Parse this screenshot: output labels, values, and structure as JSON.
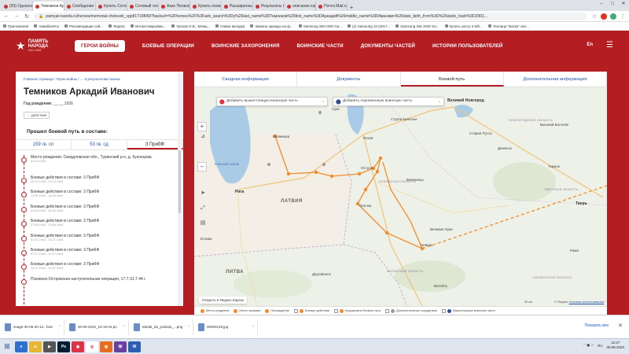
{
  "browser": {
    "tabs": [
      {
        "label": "(93) Одноклассн",
        "active": false
      },
      {
        "label": "Темников Аркади",
        "active": true
      },
      {
        "label": "Сообщения",
        "active": false
      },
      {
        "label": "Купить Сотовый",
        "active": false
      },
      {
        "label": "Сотовый телефо",
        "active": false
      },
      {
        "label": "Ахах Полиэфир",
        "active": false
      },
      {
        "label": "Купить полиэфир",
        "active": false
      },
      {
        "label": "Расширенный п",
        "active": false
      },
      {
        "label": "Результаты поис",
        "active": false
      },
      {
        "label": "описание карты",
        "active": false
      },
      {
        "label": "Почта Mail.ru",
        "active": false
      }
    ],
    "new_tab": "+",
    "win_min": "–",
    "win_max": "□",
    "win_close": "✕",
    "url": "pamyat-naroda.ru/heroes/memorial-chelovek_vpp81719849/?backurl=%2Fheroes%2F%3Fadv_search%3Dy%26last_name%3DТемников%26first_name%3DАркадий%26middle_name%3DИванович%26date_birth_from%3D%26static_hash%3D2901...",
    "bookmarks": [
      "Приложения",
      "Авиабилеты",
      "Рекомендации сай...",
      "Яндекс",
      "Интертовары/мы...",
      "Уроков О.В., Мемц...",
      "Новая вкладка",
      "Замена одежды на ф...",
      "Samsung SM-J330 Ga...",
      "(2) Samsung J3 (2017...",
      "Samsung SM-J330 Ga...",
      "Купить кассу в Wb...",
      "Теплица \"Батик\" сво..."
    ]
  },
  "site": {
    "logo_line1": "ПАМЯТЬ",
    "logo_line2": "НАРОДА",
    "logo_years": "1941-1945",
    "nav": [
      "ГЕРОИ ВОЙНЫ",
      "БОЕВЫЕ ОПЕРАЦИИ",
      "ВОИНСКИЕ ЗАХОРОНЕНИЯ",
      "ВОИНСКИЕ ЧАСТИ",
      "ДОКУМЕНТЫ ЧАСТЕЙ",
      "ИСТОРИИ ПОЛЬЗОВАТЕЛЕЙ"
    ],
    "lang": "En"
  },
  "hero": {
    "crumb_home": "Главная страница",
    "crumb_sep": " / ",
    "crumb_heroes": "Герои войны",
    "crumb_back": "← К результатам поиска",
    "name": "Темников Аркадий Иванович",
    "birth_label": "Год рождения:",
    "birth_value": "__.__.1926",
    "actions": "Действия",
    "route_title": "Прошел боевой путь в составе:",
    "units": [
      "159 гв. сп",
      "53 гв. сд",
      "3 ПрибФ"
    ],
    "timeline": [
      {
        "title": "Место рождения: Свердловская обл., Туринский р-н, д. Кузнецова",
        "date": "01.01.1926"
      },
      {
        "title": "Боевые действия в составе: 3 ПрибФ",
        "date": "26.12.1943 - 02.12.1944"
      },
      {
        "title": "Боевые действия в составе: 3 ПрибФ",
        "date": "12.05.1944 - 16.05.1944"
      },
      {
        "title": "Боевые действия в составе: 3 ПрибФ",
        "date": "01.06.1944 - 04.06.1944"
      },
      {
        "title": "Боевые действия в составе: 3 ПрибФ",
        "date": "17.06.1944 - 20.06.1944"
      },
      {
        "title": "Боевые действия в составе: 3 ПрибФ",
        "date": "01.07.1944 - 02.07.1944"
      },
      {
        "title": "Боевые действия в составе: 3 ПрибФ",
        "date": "07.07.1944 - 10.07.1944"
      },
      {
        "title": "Боевые действия в составе: 3 ПрибФ",
        "date": "15.07.1944 - 19.07.1944"
      },
      {
        "title": "Псковско-Островская наступательная операция, 17.7-31.7.44 г.",
        "date": ""
      }
    ]
  },
  "main_tabs": [
    "Сводная информация",
    "Документы",
    "Боевой путь",
    "Дополнительная информация"
  ],
  "map": {
    "select_parent": "Добавить вышестоящую воинскую часть",
    "select_child": "Добавить подчиненную воинскую часть",
    "zoom_in": "+",
    "zoom_out": "–",
    "open_yandex": "Открыть в Яндекс.Картах",
    "terms": "© Яндекс",
    "terms_link": "Условия использования",
    "scale_label": "50 км",
    "cities": [
      {
        "name": "Рига",
        "big": true
      },
      {
        "name": "Валмиера",
        "big": false
      },
      {
        "name": "Псков",
        "big": false
      },
      {
        "name": "Великий Новгород",
        "big": true
      },
      {
        "name": "Старая Русса",
        "big": false
      },
      {
        "name": "Остров",
        "big": false
      },
      {
        "name": "Опочка",
        "big": false
      },
      {
        "name": "Невель",
        "big": false
      },
      {
        "name": "Великие Луки",
        "big": false
      },
      {
        "name": "Тверь",
        "big": true
      },
      {
        "name": "Торжок",
        "big": false
      },
      {
        "name": "Демянск",
        "big": false
      },
      {
        "name": "Витебск",
        "big": false
      },
      {
        "name": "Даугавпилс",
        "big": false
      },
      {
        "name": "Ржев",
        "big": false
      },
      {
        "name": "Вышний Волочёк",
        "big": false
      },
      {
        "name": "Елгава",
        "big": false
      },
      {
        "name": "Бежаницы",
        "big": false
      },
      {
        "name": "Струги Красные",
        "big": false
      },
      {
        "name": "Гдов",
        "big": false
      }
    ],
    "regions": [
      "НОВГОРОДСКАЯ ОБЛАСТЬ",
      "ПСКОВСКАЯ ОБЛАСТЬ",
      "ТВЕРСКАЯ ОБЛАСТЬ",
      "ВИТЕБСКАЯ ОБЛАСТЬ",
      "СМОЛЕНСКАЯ ОБЛАСТЬ"
    ],
    "countries": [
      "ЛАТВИЯ",
      "ЛИТВА"
    ],
    "sea_label": "Рижский залив"
  },
  "legend": [
    "Место рождения",
    "Место призыва",
    "Награждение",
    "Боевые действия",
    "Координаты боевого пути",
    "Дополнительные координаты",
    "Вышестоящие воинские части"
  ],
  "downloads": [
    {
      "name": "image-30-06-20-12...heic",
      "type": "img"
    },
    {
      "name": "30-06-2020_10-16-04.pn",
      "type": "img"
    },
    {
      "name": "Medal_Za_pobedu_...png",
      "type": "img"
    },
    {
      "name": "00000129.jpg",
      "type": "img"
    }
  ],
  "downloads_show_all": "Показать все",
  "taskbar": {
    "lang": "RU",
    "time": "12:27",
    "date": "30.06.2020"
  },
  "colors": {
    "brand_red": "#b41e23",
    "route_orange": "#f08c2a"
  }
}
